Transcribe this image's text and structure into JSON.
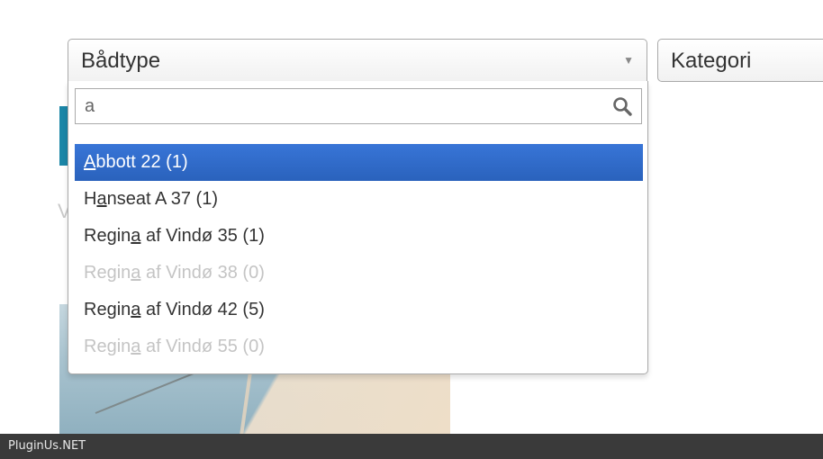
{
  "background": {
    "letter": "V"
  },
  "selects": {
    "boat_type": {
      "label": "Bådtype",
      "arrow_icon": "triangle-down-icon"
    },
    "category": {
      "label": "Kategori"
    }
  },
  "search": {
    "value": "a",
    "icon": "search-icon"
  },
  "results": [
    {
      "before": "",
      "match": "A",
      "after": "bbott 22 (1)",
      "state": "highlighted"
    },
    {
      "before": "H",
      "match": "a",
      "after": "nseat A 37 (1)",
      "state": "normal"
    },
    {
      "before": "Regin",
      "match": "a",
      "after": " af Vindø 35 (1)",
      "state": "normal"
    },
    {
      "before": "Regin",
      "match": "a",
      "after": " af Vindø 38 (0)",
      "state": "disabled"
    },
    {
      "before": "Regin",
      "match": "a",
      "after": " af Vindø 42 (5)",
      "state": "normal"
    },
    {
      "before": "Regin",
      "match": "a",
      "after": " af Vindø 55 (0)",
      "state": "disabled"
    }
  ],
  "colors": {
    "highlight": "#3875d7",
    "disabled_text": "#c4c4c4",
    "footer_bg": "#3a3a3a"
  },
  "footer": {
    "text": "PluginUs.NET"
  }
}
